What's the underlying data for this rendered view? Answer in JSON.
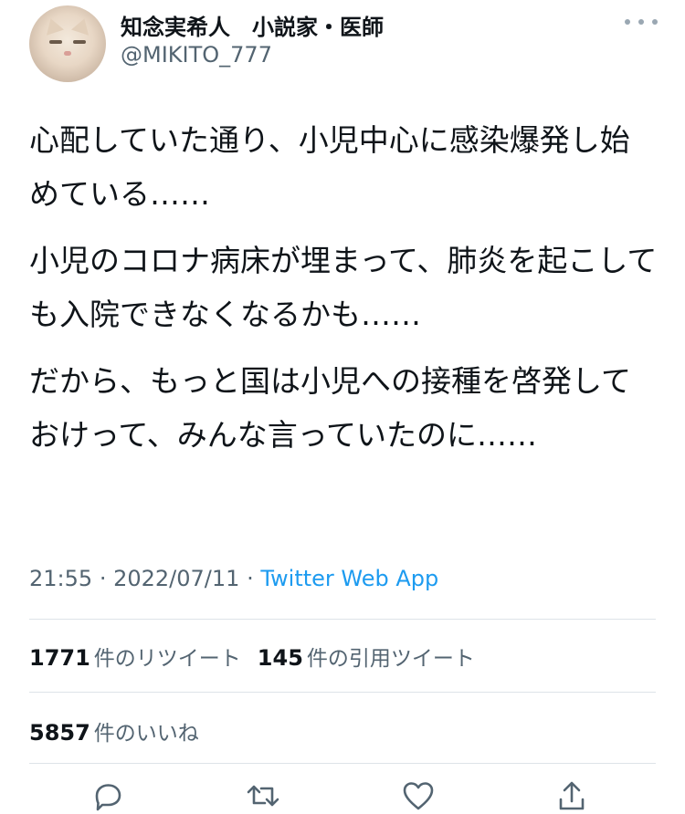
{
  "author": {
    "display_name": "知念実希人　小説家・医師",
    "handle": "@MIKITO_777"
  },
  "tweet": {
    "paragraphs": [
      "心配していた通り、小児中心に感染爆発し始めている……",
      "小児のコロナ病床が埋まって、肺炎を起こしても入院できなくなるかも……",
      "だから、もっと国は小児への接種を啓発しておけって、みんな言っていたのに……"
    ]
  },
  "meta": {
    "time": "21:55",
    "separator": "·",
    "date": "2022/07/11",
    "source": "Twitter Web App"
  },
  "stats": {
    "retweets_count": "1771",
    "retweets_label": "件のリツイート",
    "quotes_count": "145",
    "quotes_label": "件の引用ツイート",
    "likes_count": "5857",
    "likes_label": "件のいいね"
  },
  "actions": [
    "reply-icon",
    "retweet-icon",
    "like-icon",
    "share-icon"
  ],
  "colors": {
    "text": "#0f1419",
    "secondary": "#536471",
    "link": "#1d9bf0",
    "divider": "#dde3e8"
  }
}
